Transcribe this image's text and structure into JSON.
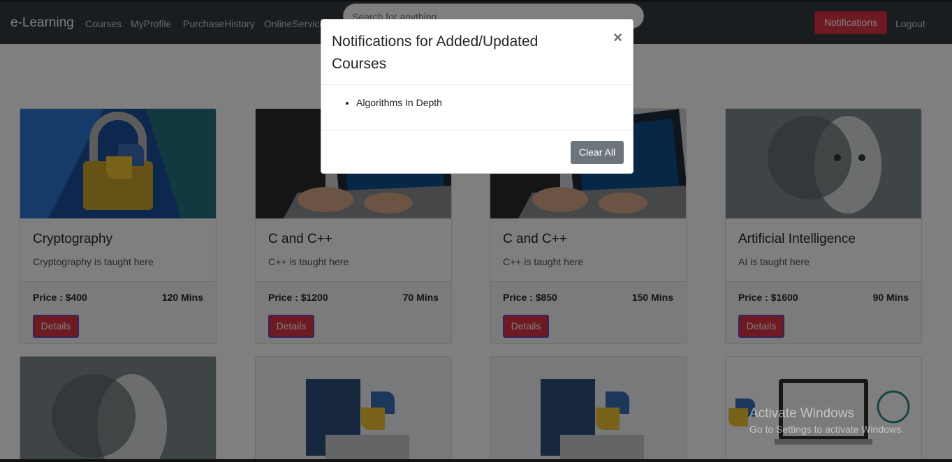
{
  "navbar": {
    "brand": "e-Learning",
    "links": [
      "Courses",
      "MyProfile",
      "PurchaseHistory",
      "OnlineServices"
    ],
    "search_placeholder": "Search for anything",
    "notifications_label": "Notifications",
    "logout_label": "Logout"
  },
  "courses": [
    {
      "title": "Cryptography",
      "description": "Cryptography is taught here",
      "price": "Price : $400",
      "duration": "120 Mins",
      "details_label": "Details",
      "image": "padlock-python-image"
    },
    {
      "title": "C and C++",
      "description": "C++ is taught here",
      "price": "Price : $1200",
      "duration": "70 Mins",
      "details_label": "Details",
      "image": "laptop-coding-image"
    },
    {
      "title": "C and C++",
      "description": "C++ is taught here",
      "price": "Price : $850",
      "duration": "150 Mins",
      "details_label": "Details",
      "image": "laptop-coding-image"
    },
    {
      "title": "Artificial Intelligence",
      "description": "AI is taught here",
      "price": "Price : $1600",
      "duration": "90 Mins",
      "details_label": "Details",
      "image": "ai-face-image"
    }
  ],
  "second_row_images": [
    "ai-face-image",
    "python-flowchart-image",
    "python-flowchart-image",
    "python-datascience-image"
  ],
  "modal": {
    "title": "Notifications for Added/Updated Courses",
    "close_symbol": "×",
    "items": [
      "Algorithms In Depth"
    ],
    "clear_label": "Clear All"
  },
  "watermark": {
    "line1": "Activate Windows",
    "line2": "Go to Settings to activate Windows."
  },
  "colors": {
    "navbar": "#343a40",
    "danger": "#dc3545",
    "secondary": "#6c757d"
  }
}
